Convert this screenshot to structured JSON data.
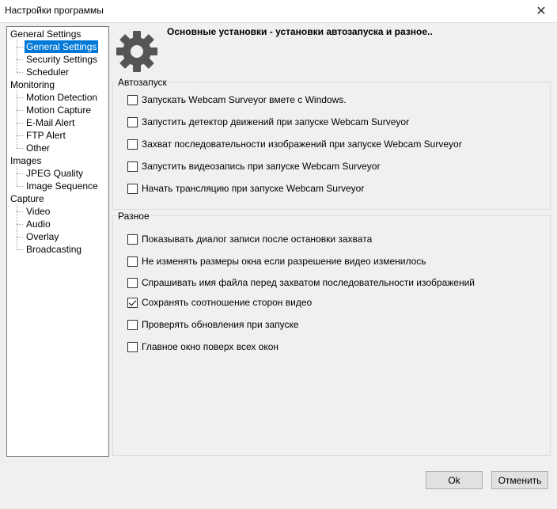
{
  "window": {
    "title": "Настройки программы",
    "close_glyph": "✕"
  },
  "tree": {
    "nodes": [
      {
        "label": "General Settings",
        "level": 0
      },
      {
        "label": "General Settings",
        "level": 1,
        "selected": true
      },
      {
        "label": "Security Settings",
        "level": 1
      },
      {
        "label": "Scheduler",
        "level": 1
      },
      {
        "label": "Monitoring",
        "level": 0
      },
      {
        "label": "Motion Detection",
        "level": 1
      },
      {
        "label": "Motion Capture",
        "level": 1
      },
      {
        "label": "E-Mail Alert",
        "level": 1
      },
      {
        "label": "FTP Alert",
        "level": 1
      },
      {
        "label": "Other",
        "level": 1
      },
      {
        "label": "Images",
        "level": 0
      },
      {
        "label": "JPEG Quality",
        "level": 1
      },
      {
        "label": "Image Sequence",
        "level": 1
      },
      {
        "label": "Capture",
        "level": 0
      },
      {
        "label": "Video",
        "level": 1
      },
      {
        "label": "Audio",
        "level": 1
      },
      {
        "label": "Overlay",
        "level": 1
      },
      {
        "label": "Broadcasting",
        "level": 1
      }
    ]
  },
  "header": {
    "icon": "gear-icon",
    "title": "Основные установки - установки автозапуска и разное.."
  },
  "autostart": {
    "label": "Автозапуск",
    "items": [
      {
        "label": "Запускать Webcam Surveyor вмете с Windows.",
        "checked": false
      },
      {
        "label": "Запустить детектор движений при запуске Webcam Surveyor",
        "checked": false
      },
      {
        "label": "Захват последовательности изображений при запуске Webcam Surveyor",
        "checked": false
      },
      {
        "label": "Запустить видеозапись при запуске Webcam Surveyor",
        "checked": false
      },
      {
        "label": "Начать трансляцию при запуске Webcam Surveyor",
        "checked": false
      }
    ]
  },
  "misc": {
    "label": "Разное",
    "items": [
      {
        "label": "Показывать диалог записи после остановки захвата",
        "checked": false
      },
      {
        "label": "Не изменять размеры окна если разрешение видео изменилось",
        "checked": false
      },
      {
        "label": "Спрашивать имя файла перед захватом последовательности изображений",
        "checked": false
      },
      {
        "label": "Сохранять соотношение сторон видео",
        "checked": true
      },
      {
        "label": "Проверять обновления при запуске",
        "checked": false
      },
      {
        "label": "Главное окно поверх всех окон",
        "checked": false
      }
    ]
  },
  "buttons": {
    "ok": "Ok",
    "cancel": "Отменить"
  },
  "colors": {
    "selection": "#0078d7",
    "background": "#f0f0f0"
  }
}
